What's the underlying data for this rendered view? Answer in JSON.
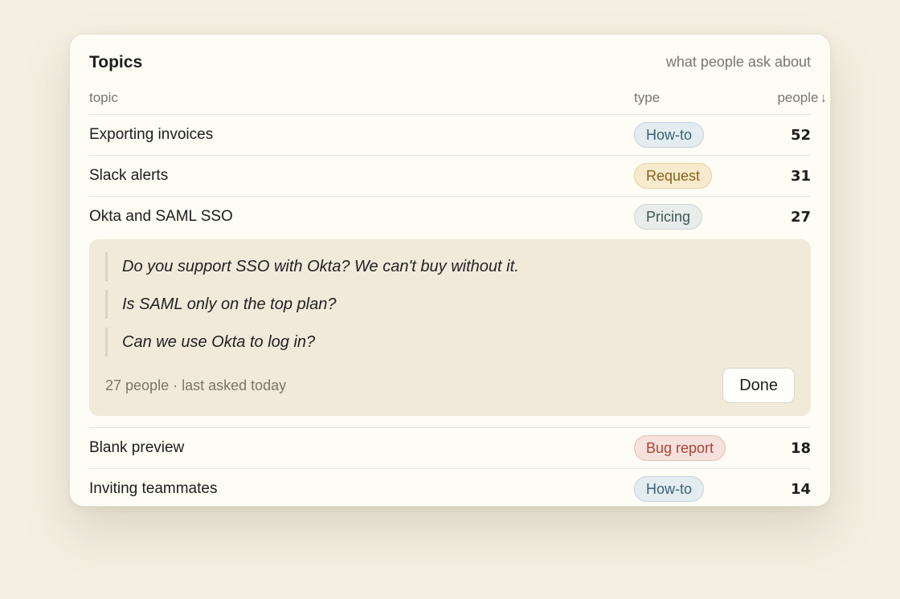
{
  "header": {
    "title": "Topics",
    "subtitle": "what people ask about"
  },
  "columns": {
    "topic": "topic",
    "type": "type",
    "people": "people",
    "sort_arrow": "↓"
  },
  "rows_top": [
    {
      "topic": "Exporting invoices",
      "type": "How-to",
      "type_kind": "howto",
      "count": "52"
    },
    {
      "topic": "Slack alerts",
      "type": "Request",
      "type_kind": "request",
      "count": "31"
    },
    {
      "topic": "Okta and SAML SSO",
      "type": "Pricing",
      "type_kind": "pricing",
      "count": "27"
    }
  ],
  "detail": {
    "quotes": [
      "Do you support SSO with Okta? We can't buy without it.",
      "Is SAML only on the top plan?",
      "Can we use Okta to log in?"
    ],
    "meta": "27 people · last asked today",
    "done_label": "Done"
  },
  "rows_bottom": [
    {
      "topic": "Blank preview",
      "type": "Bug report",
      "type_kind": "bug",
      "count": "18"
    },
    {
      "topic": "Inviting teammates",
      "type": "How-to",
      "type_kind": "howto",
      "count": "14"
    }
  ],
  "colors": {
    "background": "#f3efe2",
    "card": "#fdfcf5",
    "detail_bg": "#f1e9da"
  }
}
